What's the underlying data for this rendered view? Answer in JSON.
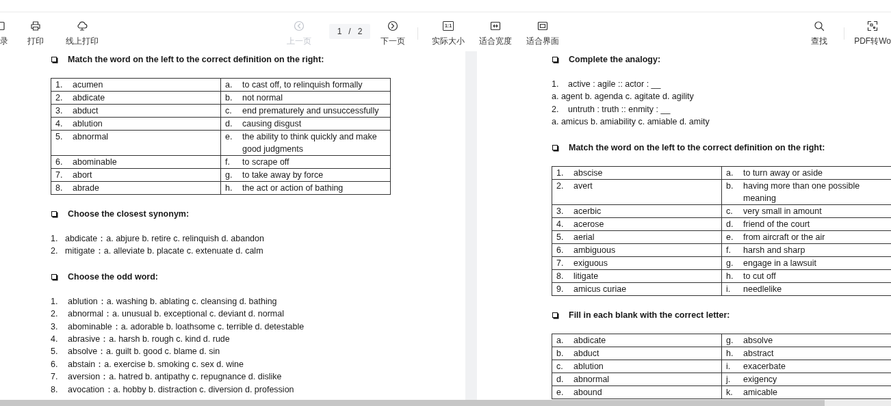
{
  "toolbar": {
    "left": [
      {
        "kind": "outline",
        "label": "录"
      },
      {
        "kind": "printer",
        "label": "打印"
      },
      {
        "kind": "cloud",
        "label": "线上打印"
      }
    ],
    "prev": {
      "label": "上一页",
      "disabled": true
    },
    "page": {
      "current": "1",
      "separator": "/",
      "total": "2"
    },
    "next": {
      "label": "下一页",
      "disabled": false
    },
    "view": [
      {
        "kind": "actual",
        "icon_text": "1:1",
        "label": "实际大小"
      },
      {
        "kind": "fit_width",
        "label": "适合宽度"
      },
      {
        "kind": "fit_page",
        "label": "适合界面"
      }
    ],
    "right": [
      {
        "kind": "search",
        "label": "查找"
      },
      {
        "kind": "convert",
        "label": "PDF转Wo"
      }
    ]
  },
  "pages": [
    {
      "sections": [
        {
          "kind": "table",
          "heading": "Match the word on the left to the correct definition on the right:",
          "rows": [
            {
              "left_label": "1.",
              "left_text": "acumen",
              "right_label": "a.",
              "right_text": "to cast off, to relinquish formally"
            },
            {
              "left_label": "2.",
              "left_text": "abdicate",
              "right_label": "b.",
              "right_text": "not normal"
            },
            {
              "left_label": "3.",
              "left_text": "abduct",
              "right_label": "c.",
              "right_text": "end prematurely and unsuccessfully"
            },
            {
              "left_label": "4.",
              "left_text": "ablution",
              "right_label": "d.",
              "right_text": "causing disgust"
            },
            {
              "left_label": "5.",
              "left_text": "abnormal",
              "right_label": "e.",
              "right_text": "the ability to think quickly and make good judgments"
            },
            {
              "left_label": "6.",
              "left_text": "abominable",
              "right_label": "f.",
              "right_text": "to scrape off"
            },
            {
              "left_label": "7.",
              "left_text": "abort",
              "right_label": "g.",
              "right_text": "to take away by force"
            },
            {
              "left_label": "8.",
              "left_text": "abrade",
              "right_label": "h.",
              "right_text": "the act or action of bathing"
            }
          ]
        },
        {
          "kind": "list",
          "heading": "Choose the closest synonym:",
          "items": [
            {
              "number": "1.",
              "text": "abdicate：a. abjure b. retire c. relinquish d. abandon"
            },
            {
              "number": "2.",
              "text": "mitigate：a. alleviate b. placate c. extenuate d. calm"
            }
          ]
        },
        {
          "kind": "list",
          "heading": "Choose the odd word:",
          "items": [
            {
              "number": "1.",
              "text": "ablution：a. washing b. ablating c. cleansing d. bathing"
            },
            {
              "number": "2.",
              "text": "abnormal：a. unusual b. exceptional c. deviant d. normal"
            },
            {
              "number": "3.",
              "text": "abominable：a. adorable b. loathsome c. terrible d. detestable"
            },
            {
              "number": "4.",
              "text": "abrasive：a. harsh b. rough c. kind d. rude"
            },
            {
              "number": "5.",
              "text": "absolve：a. guilt b. good c. blame d. sin"
            },
            {
              "number": "6.",
              "text": "abstain：a. exercise b. smoking c. sex d. wine"
            },
            {
              "number": "7.",
              "text": "aversion：a. hatred b. antipathy c. repugnance d. dislike"
            },
            {
              "number": "8.",
              "text": "avocation：a. hobby b. distraction c. diversion d. profession"
            }
          ]
        }
      ]
    },
    {
      "sections": [
        {
          "kind": "list",
          "heading": "Complete the analogy:",
          "items": [
            {
              "number": "1.",
              "text": "active : agile :: actor : __"
            },
            {
              "text": "a. agent b. agenda c. agitate d. agility"
            },
            {
              "number": "2.",
              "text": "untruth : truth :: enmity : __"
            },
            {
              "text": "a. amicus b. amiability c. amiable d. amity"
            }
          ]
        },
        {
          "kind": "table",
          "heading": "Match the word on the left to the correct definition on the right:",
          "rows": [
            {
              "left_label": "1.",
              "left_text": "abscise",
              "right_label": "a.",
              "right_text": "to turn away or aside"
            },
            {
              "left_label": "2.",
              "left_text": "avert",
              "right_label": "b.",
              "right_text": "having more than one possible meaning"
            },
            {
              "left_label": "3.",
              "left_text": "acerbic",
              "right_label": "c.",
              "right_text": "very small in amount"
            },
            {
              "left_label": "4.",
              "left_text": "acerose",
              "right_label": "d.",
              "right_text": "friend of the court"
            },
            {
              "left_label": "5.",
              "left_text": "aerial",
              "right_label": "e.",
              "right_text": "from aircraft or the air"
            },
            {
              "left_label": "6.",
              "left_text": "ambiguous",
              "right_label": "f.",
              "right_text": "harsh and sharp"
            },
            {
              "left_label": "7.",
              "left_text": "exiguous",
              "right_label": "g.",
              "right_text": "engage in a lawsuit"
            },
            {
              "left_label": "8.",
              "left_text": "litigate",
              "right_label": "h.",
              "right_text": "to cut off"
            },
            {
              "left_label": "9.",
              "left_text": "amicus curiae",
              "right_label": "i.",
              "right_text": "needlelike"
            }
          ]
        },
        {
          "kind": "table",
          "heading": "Fill in each blank with the correct letter:",
          "rows": [
            {
              "left_label": "a.",
              "left_text": "abdicate",
              "right_label": "g.",
              "right_text": "absolve"
            },
            {
              "left_label": "b.",
              "left_text": "abduct",
              "right_label": "h.",
              "right_text": "abstract"
            },
            {
              "left_label": "c.",
              "left_text": "ablution",
              "right_label": "i.",
              "right_text": "exacerbate"
            },
            {
              "left_label": "d.",
              "left_text": "abnormal",
              "right_label": "j.",
              "right_text": "exigency"
            },
            {
              "left_label": "e.",
              "left_text": "abound",
              "right_label": "k.",
              "right_text": "amicable"
            }
          ]
        }
      ]
    }
  ]
}
